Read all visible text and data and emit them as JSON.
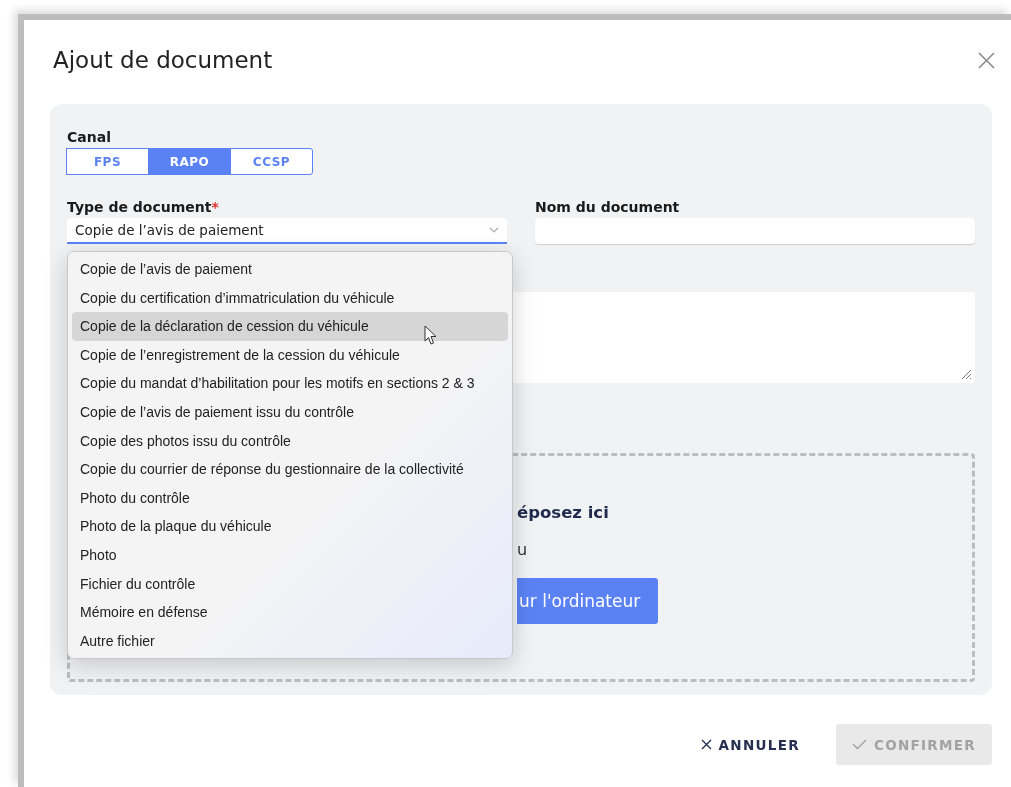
{
  "dialog": {
    "title": "Ajout de document"
  },
  "canal": {
    "label": "Canal",
    "options": [
      {
        "label": "FPS",
        "selected": false
      },
      {
        "label": "RAPO",
        "selected": true
      },
      {
        "label": "CCSP",
        "selected": false
      }
    ]
  },
  "type_document": {
    "label": "Type de document",
    "required_mark": "*",
    "value": "Copie de l’avis de paiement",
    "options": [
      {
        "label": "Copie de l’avis de paiement",
        "highlighted": false
      },
      {
        "label": "Copie du certification d’immatriculation du véhicule",
        "highlighted": false
      },
      {
        "label": "Copie de la déclaration de cession du véhicule",
        "highlighted": true
      },
      {
        "label": "Copie de l’enregistrement de la cession du véhicule",
        "highlighted": false
      },
      {
        "label": "Copie du mandat d’habilitation pour les motifs en sections 2 & 3",
        "highlighted": false
      },
      {
        "label": "Copie de l’avis de paiement issu du contrôle",
        "highlighted": false
      },
      {
        "label": "Copie des photos issu du contrôle",
        "highlighted": false
      },
      {
        "label": "Copie du courrier de réponse du gestionnaire de la collectivité",
        "highlighted": false
      },
      {
        "label": "Photo du contrôle",
        "highlighted": false
      },
      {
        "label": "Photo de la plaque du véhicule",
        "highlighted": false
      },
      {
        "label": "Photo",
        "highlighted": false
      },
      {
        "label": "Fichier du contrôle",
        "highlighted": false
      },
      {
        "label": "Mémoire en défense",
        "highlighted": false
      },
      {
        "label": "Autre fichier",
        "highlighted": false
      }
    ]
  },
  "nom_document": {
    "label": "Nom du document"
  },
  "drop_zone": {
    "title": "éposez ici",
    "separator": "u",
    "button": "ur l'ordinateur"
  },
  "buttons": [
    {
      "label": "ANNULER",
      "kind": "cancel",
      "disabled": false
    },
    {
      "label": "CONFIRMER",
      "kind": "confirm",
      "disabled": true
    }
  ]
}
